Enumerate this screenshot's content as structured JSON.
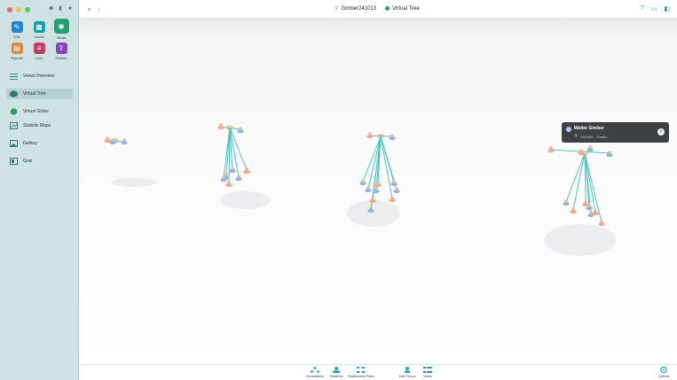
{
  "window": {
    "title": "Gimber241013",
    "view": "Virtual Tree"
  },
  "toolbar": {
    "items": [
      {
        "label": "Edit",
        "icon": "pencil-icon",
        "color": "#1f86d6"
      },
      {
        "label": "Charts",
        "icon": "charts-icon",
        "color": "#1aa0a3"
      },
      {
        "label": "Views",
        "icon": "eye-icon",
        "color": "#20a36f"
      },
      {
        "label": "Reports",
        "icon": "reports-icon",
        "color": "#e3873a"
      },
      {
        "label": "Lists",
        "icon": "lists-icon",
        "color": "#c23f6a"
      },
      {
        "label": "Publish",
        "icon": "publish-icon",
        "color": "#8a44b8"
      }
    ]
  },
  "sidebar": {
    "items": [
      {
        "label": "Views Overview",
        "icon": "list-icon"
      },
      {
        "label": "Virtual Tree",
        "icon": "tree-3d-icon",
        "selected": true
      },
      {
        "label": "Virtual Globe",
        "icon": "globe-icon"
      },
      {
        "label": "Statistic Maps",
        "icon": "map-icon"
      },
      {
        "label": "Gallery",
        "icon": "gallery-icon"
      },
      {
        "label": "Quiz",
        "icon": "quiz-icon"
      }
    ]
  },
  "tooltip": {
    "name": "Walter Gimber",
    "date": "03/1925 – Death"
  },
  "bottombar": {
    "items": [
      {
        "label": "Generations",
        "icon": "generations-icon"
      },
      {
        "label": "Relatives",
        "icon": "relatives-icon"
      },
      {
        "label": "Relationship Paths",
        "icon": "relationship-paths-icon"
      },
      {
        "label": "Edit Person",
        "icon": "edit-person-icon"
      },
      {
        "label": "Views",
        "icon": "views-icon"
      }
    ],
    "options_label": "Options"
  },
  "colors": {
    "accent": "#25a4a7",
    "sidebar_bg": "#cfe3e5",
    "link_line": "#4ec4c0",
    "male": "#8fb4e6",
    "female": "#f0a98d"
  }
}
